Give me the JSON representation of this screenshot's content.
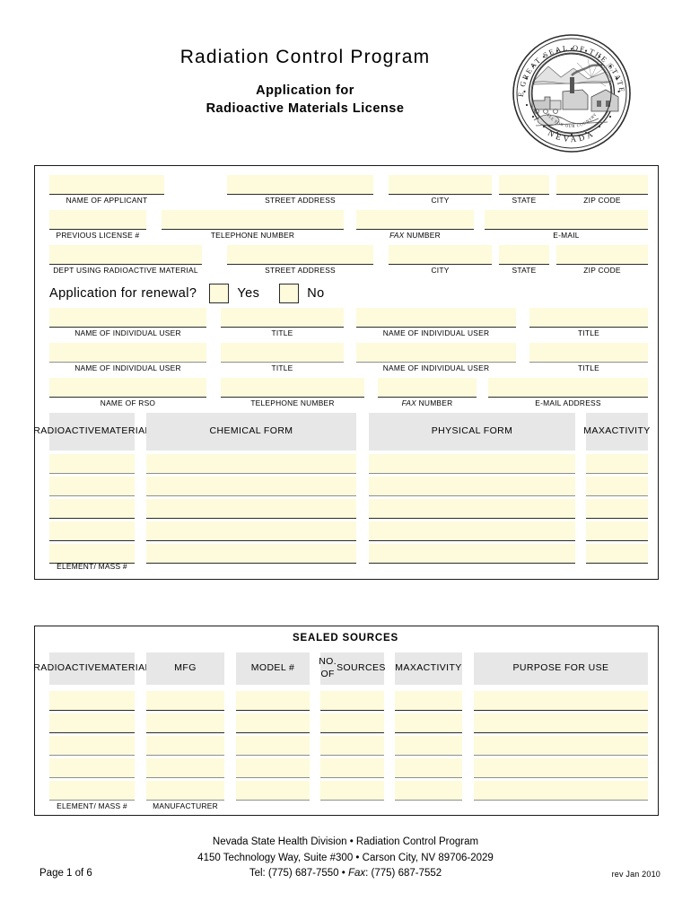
{
  "header": {
    "program_title": "Radiation Control Program",
    "subtitle_line1": "Application for",
    "subtitle_line2": "Radioactive Materials License",
    "seal": {
      "outer_text": "THE GREAT SEAL OF THE STATE OF",
      "bottom_text": "NEVADA",
      "motto": "ALL FOR OUR COUNTRY"
    }
  },
  "applicant_section": {
    "row1": [
      {
        "caption": "NAME OF APPLICANT",
        "value": ""
      },
      {
        "caption": "STREET ADDRESS",
        "value": ""
      },
      {
        "caption": "CITY",
        "value": ""
      },
      {
        "caption": "STATE",
        "value": ""
      },
      {
        "caption": "ZIP CODE",
        "value": ""
      }
    ],
    "row2": [
      {
        "caption": "PREVIOUS LICENSE #",
        "value": ""
      },
      {
        "caption": "TELEPHONE NUMBER",
        "value": ""
      },
      {
        "caption": "FAX NUMBER",
        "caption_italic": "FAX",
        "caption_rest": " NUMBER",
        "value": ""
      },
      {
        "caption": "E-MAIL",
        "value": ""
      }
    ],
    "row3": [
      {
        "caption": "DEPT USING RADIOACTIVE MATERIAL",
        "value": ""
      },
      {
        "caption": "STREET ADDRESS",
        "value": ""
      },
      {
        "caption": "CITY",
        "value": ""
      },
      {
        "caption": "STATE",
        "value": ""
      },
      {
        "caption": "ZIP CODE",
        "value": ""
      }
    ],
    "renewal": {
      "question": "Application for renewal?",
      "yes_label": "Yes",
      "no_label": "No",
      "yes_checked": false,
      "no_checked": false
    },
    "users_row1": [
      {
        "caption": "NAME OF INDIVIDUAL USER",
        "value": ""
      },
      {
        "caption": "TITLE",
        "value": ""
      },
      {
        "caption": "NAME OF INDIVIDUAL USER",
        "value": ""
      },
      {
        "caption": "TITLE",
        "value": ""
      }
    ],
    "users_row2": [
      {
        "caption": "NAME OF INDIVIDUAL USER",
        "value": ""
      },
      {
        "caption": "TITLE",
        "value": ""
      },
      {
        "caption": "NAME OF INDIVIDUAL USER",
        "value": ""
      },
      {
        "caption": "TITLE",
        "value": ""
      }
    ],
    "rso_row": [
      {
        "caption": "NAME OF RSO",
        "value": ""
      },
      {
        "caption": "TELEPHONE NUMBER",
        "value": ""
      },
      {
        "caption": "FAX NUMBER",
        "caption_italic": "FAX",
        "caption_rest": " NUMBER",
        "value": ""
      },
      {
        "caption": "E-MAIL ADDRESS",
        "value": ""
      }
    ]
  },
  "material_table": {
    "headers": [
      "RADIOACTIVE\nMATERIAL",
      "CHEMICAL FORM",
      "PHYSICAL FORM",
      "MAX\nACTIVITY"
    ],
    "rows": [
      [
        "",
        "",
        "",
        ""
      ],
      [
        "",
        "",
        "",
        ""
      ],
      [
        "",
        "",
        "",
        ""
      ],
      [
        "",
        "",
        "",
        ""
      ],
      [
        "",
        "",
        "",
        ""
      ]
    ],
    "footnote_col1": "ELEMENT/ MASS #"
  },
  "sealed_sources": {
    "section_title": "SEALED SOURCES",
    "headers": [
      "RADIOACTIVE\nMATERIAL",
      "MFG",
      "MODEL #",
      "NO. OF\nSOURCES",
      "MAX\nACTIVITY",
      "PURPOSE FOR USE"
    ],
    "rows": [
      [
        "",
        "",
        "",
        "",
        "",
        ""
      ],
      [
        "",
        "",
        "",
        "",
        "",
        ""
      ],
      [
        "",
        "",
        "",
        "",
        "",
        ""
      ],
      [
        "",
        "",
        "",
        "",
        "",
        ""
      ],
      [
        "",
        "",
        "",
        "",
        "",
        ""
      ]
    ],
    "footnote_col1": "ELEMENT/ MASS #",
    "footnote_col2": "MANUFACTURER"
  },
  "footer": {
    "line1": "Nevada State Health Division  •  Radiation Control Program",
    "line2": "4150 Technology Way, Suite #300  •  Carson City, NV 89706-2029",
    "line3_pre": "Tel: (775) 687-7550  •  ",
    "line3_ital": "Fax",
    "line3_post": ": (775) 687-7552",
    "page": "Page 1 of 6",
    "revision": "rev Jan 2010"
  },
  "colors": {
    "field_fill": "#fdfbdc",
    "header_fill": "#e7e7e7",
    "rule_dark": "#2b2b2b",
    "rule_gray": "#8f8f8f",
    "border": "#1a1a1a"
  }
}
